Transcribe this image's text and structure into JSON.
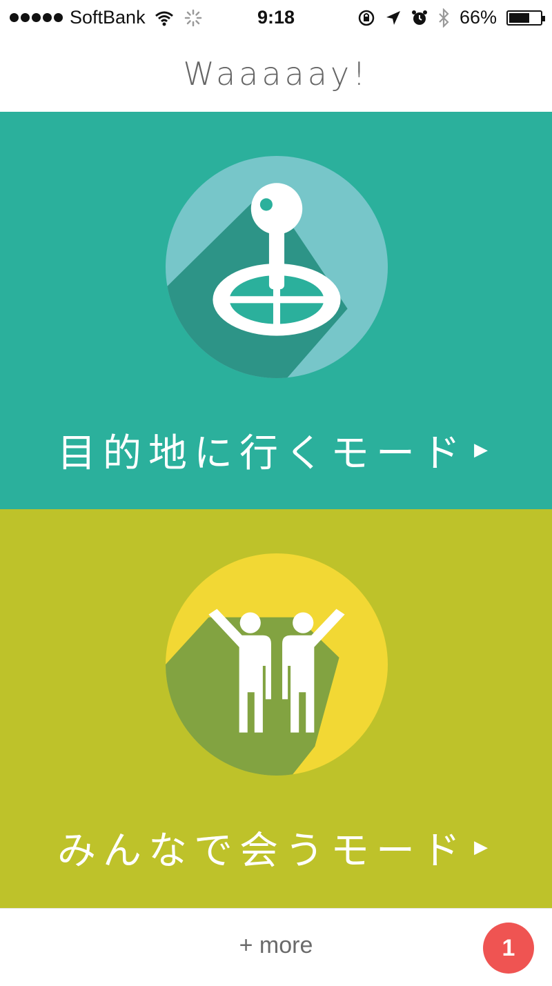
{
  "status_bar": {
    "carrier": "SoftBank",
    "time": "9:18",
    "battery_percent_label": "66%",
    "battery_level": 0.66,
    "icons": [
      "signal-dots-icon",
      "wifi-icon",
      "activity-spinner-icon",
      "lock-rotation-icon",
      "location-arrow-icon",
      "alarm-icon",
      "bluetooth-icon",
      "battery-icon"
    ]
  },
  "nav": {
    "title": "Waaaaay!"
  },
  "modes": [
    {
      "label": "目的地に行くモード",
      "icon": "joystick-target-icon",
      "background": "#2bb09c",
      "circle_color": "#77c6c9",
      "shadow_color": "#2d9487"
    },
    {
      "label": "みんなで会うモード",
      "icon": "two-people-waving-icon",
      "background": "#bec22a",
      "circle_color": "#f2d834",
      "shadow_color": "#82a341"
    }
  ],
  "footer": {
    "more_label": "+ more",
    "badge_count": "1",
    "badge_color": "#ef5452"
  }
}
